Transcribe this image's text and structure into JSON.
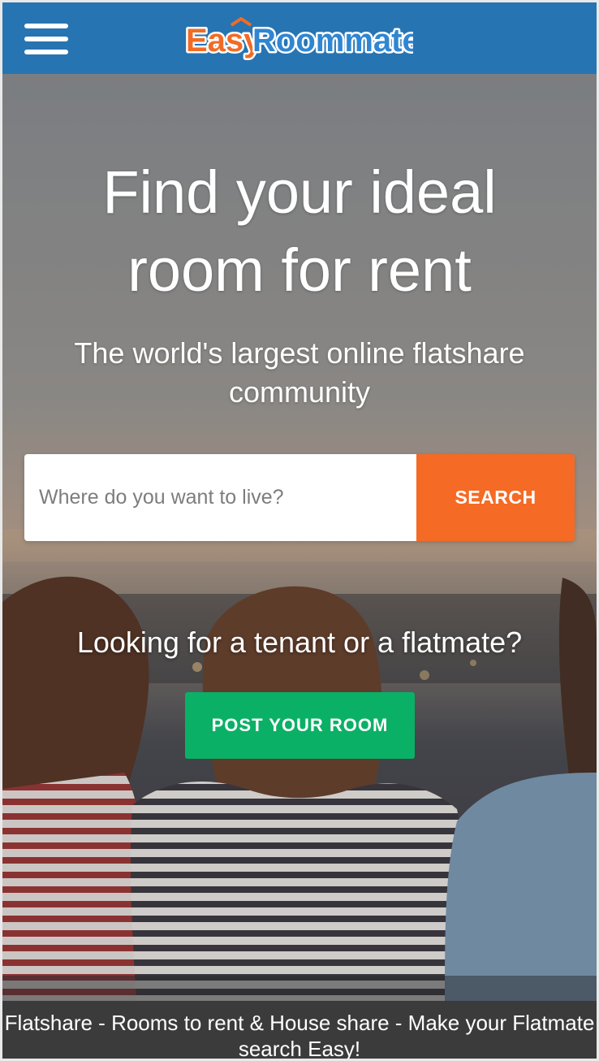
{
  "header": {
    "menu_icon": "hamburger-menu-icon",
    "logo": {
      "part1": "Easy",
      "part2": "Roommate",
      "colors": {
        "easy": "#f26b25",
        "roommate": "#2f86d2",
        "outline": "#ffffff"
      }
    },
    "background_color": "#2774b2"
  },
  "hero": {
    "headline": "Find your ideal room for rent",
    "subheadline": "The world's largest online flatshare community",
    "search": {
      "placeholder": "Where do you want to live?",
      "value": "",
      "button_label": "SEARCH",
      "button_color": "#f56a25"
    },
    "cta_question": "Looking for a tenant or a flatmate?",
    "cta_button_label": "POST YOUR ROOM",
    "cta_button_color": "#0ab066"
  },
  "footer": {
    "text": "Flatshare - Rooms to rent & House share - Make your Flatmate search Easy!"
  }
}
